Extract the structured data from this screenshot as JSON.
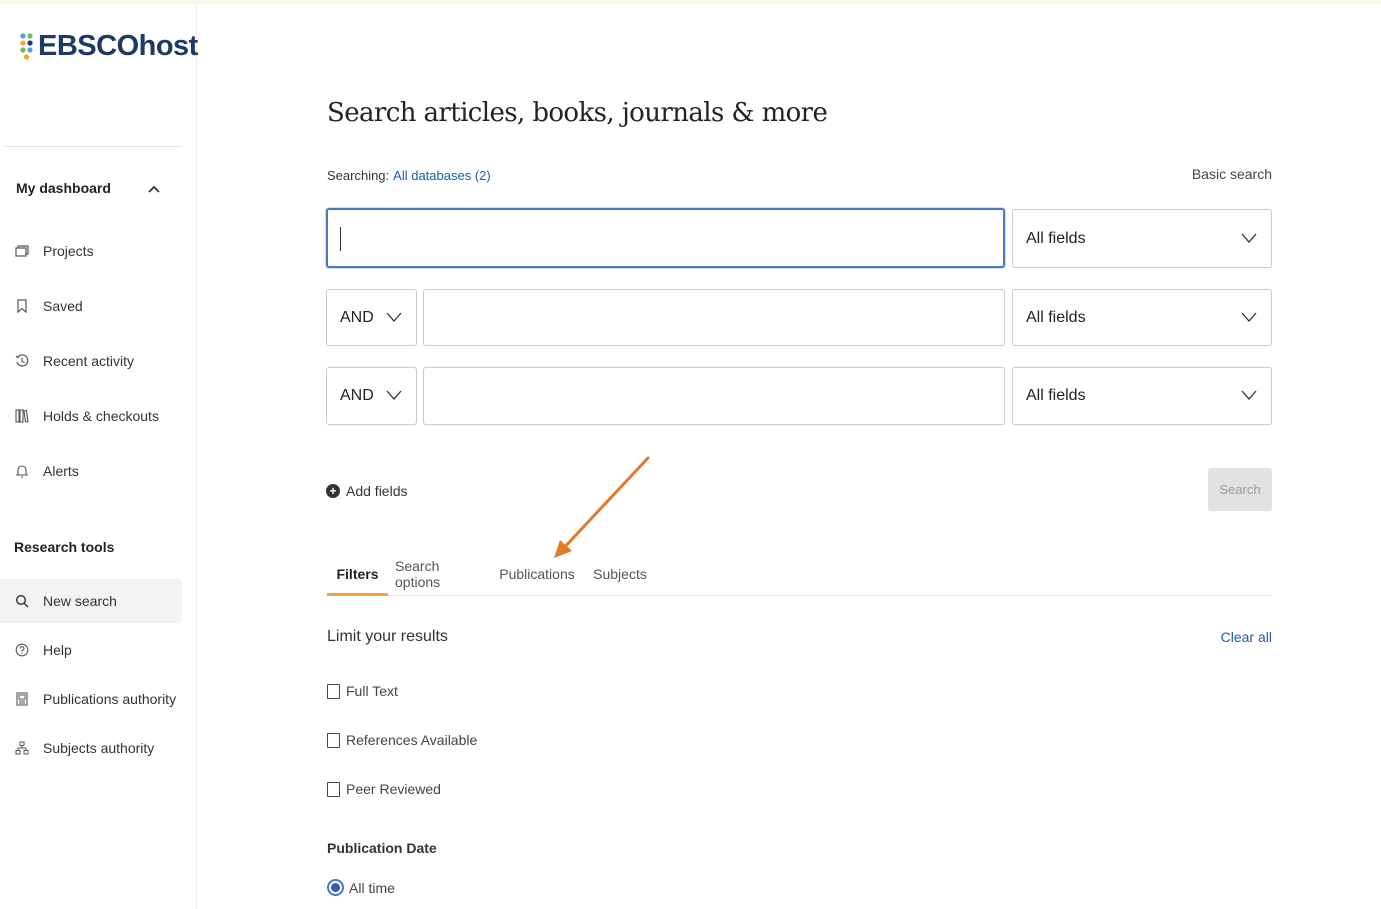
{
  "brand": {
    "name": "EBSCOhost",
    "logo_colors": [
      "#1d3a66",
      "#5a9fd4",
      "#f4a42f",
      "#6bbf59"
    ]
  },
  "sidebar": {
    "dashboard_label": "My dashboard",
    "dashboard_items": [
      {
        "label": "Projects",
        "icon": "projects-icon"
      },
      {
        "label": "Saved",
        "icon": "bookmark-icon"
      },
      {
        "label": "Recent activity",
        "icon": "history-icon"
      },
      {
        "label": "Holds & checkouts",
        "icon": "books-icon"
      },
      {
        "label": "Alerts",
        "icon": "bell-icon"
      }
    ],
    "tools_label": "Research tools",
    "tools_items": [
      {
        "label": "New search",
        "icon": "search-icon",
        "active": true
      },
      {
        "label": "Help",
        "icon": "help-icon"
      },
      {
        "label": "Publications authority",
        "icon": "publication-icon"
      },
      {
        "label": "Subjects authority",
        "icon": "hierarchy-icon"
      }
    ]
  },
  "main": {
    "title": "Search articles, books, journals & more",
    "searching_label": "Searching:",
    "databases_link": "All databases (2)",
    "basic_search": "Basic search",
    "rows": [
      {
        "operator": "",
        "field": "All fields",
        "value": ""
      },
      {
        "operator": "AND",
        "field": "All fields",
        "value": ""
      },
      {
        "operator": "AND",
        "field": "All fields",
        "value": ""
      }
    ],
    "add_fields": "Add fields",
    "search_button": "Search",
    "tabs": [
      "Filters",
      "Search options",
      "Publications",
      "Subjects"
    ],
    "active_tab": "Filters",
    "limit_title": "Limit your results",
    "clear_all": "Clear all",
    "limiters": [
      {
        "label": "Full Text",
        "checked": false
      },
      {
        "label": "References Available",
        "checked": false
      },
      {
        "label": "Peer Reviewed",
        "checked": false
      }
    ],
    "publication_date_label": "Publication Date",
    "publication_date_option": "All time",
    "annotation_color": "#e07a2a"
  }
}
